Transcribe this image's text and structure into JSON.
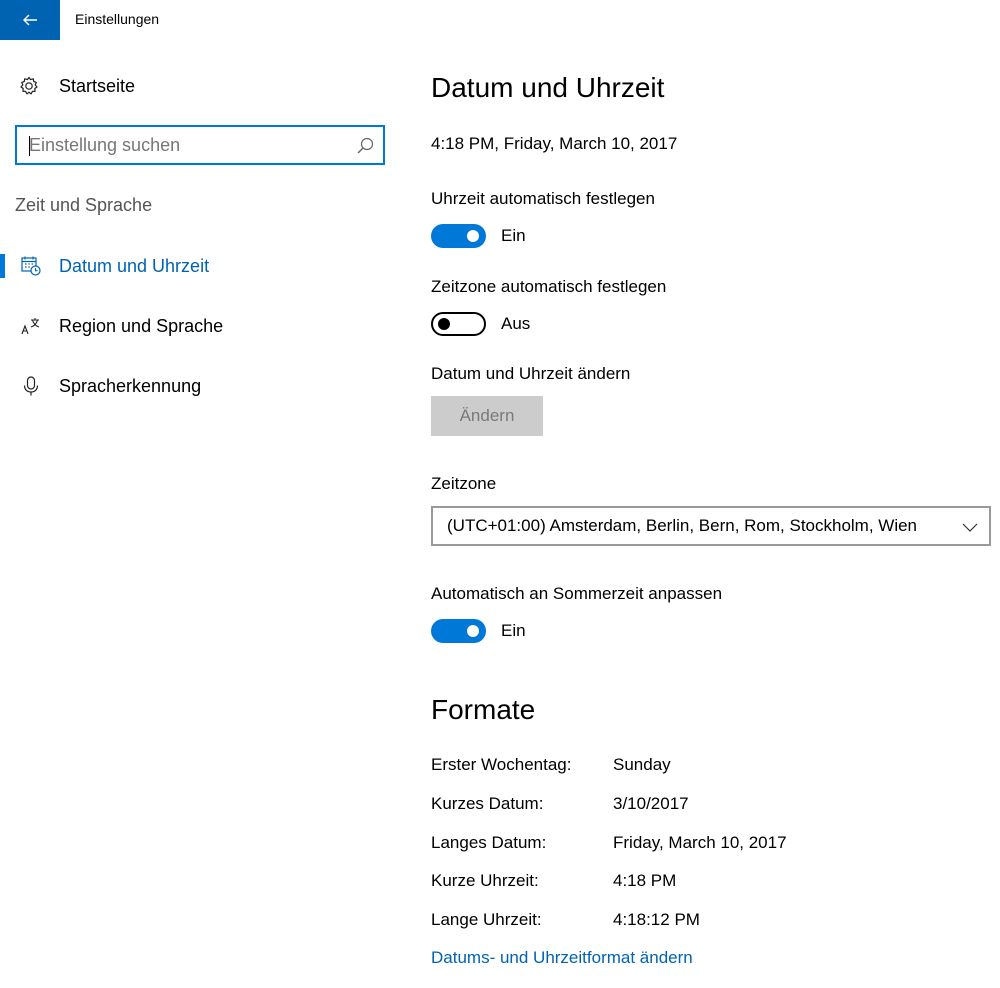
{
  "window": {
    "title": "Einstellungen"
  },
  "sidebar": {
    "home_label": "Startseite",
    "search": {
      "placeholder": "Einstellung suchen",
      "value": ""
    },
    "group_label": "Zeit und Sprache",
    "items": [
      {
        "label": "Datum und Uhrzeit",
        "icon": "calendar-clock-icon",
        "active": true
      },
      {
        "label": "Region und Sprache",
        "icon": "language-icon",
        "active": false
      },
      {
        "label": "Spracherkennung",
        "icon": "microphone-icon",
        "active": false
      }
    ]
  },
  "main": {
    "title": "Datum und Uhrzeit",
    "current_datetime": "4:18 PM, Friday, March 10, 2017",
    "auto_time": {
      "label": "Uhrzeit automatisch festlegen",
      "state": "Ein",
      "on": true
    },
    "auto_timezone": {
      "label": "Zeitzone automatisch festlegen",
      "state": "Aus",
      "on": false
    },
    "change_datetime": {
      "label": "Datum und Uhrzeit ändern",
      "button": "Ändern"
    },
    "timezone": {
      "label": "Zeitzone",
      "value": "(UTC+01:00) Amsterdam, Berlin, Bern, Rom, Stockholm, Wien"
    },
    "dst": {
      "label": "Automatisch an Sommerzeit anpassen",
      "state": "Ein",
      "on": true
    },
    "formats": {
      "title": "Formate",
      "rows": [
        {
          "key": "Erster Wochentag:",
          "value": "Sunday"
        },
        {
          "key": "Kurzes Datum:",
          "value": "3/10/2017"
        },
        {
          "key": "Langes Datum:",
          "value": "Friday, March 10, 2017"
        },
        {
          "key": "Kurze Uhrzeit:",
          "value": "4:18 PM"
        },
        {
          "key": "Lange Uhrzeit:",
          "value": "4:18:12 PM"
        }
      ],
      "link": "Datums- und Uhrzeitformat ändern"
    }
  },
  "colors": {
    "accent": "#0078d7",
    "accent_dark": "#0063b1",
    "disabled_bg": "#cccccc"
  }
}
